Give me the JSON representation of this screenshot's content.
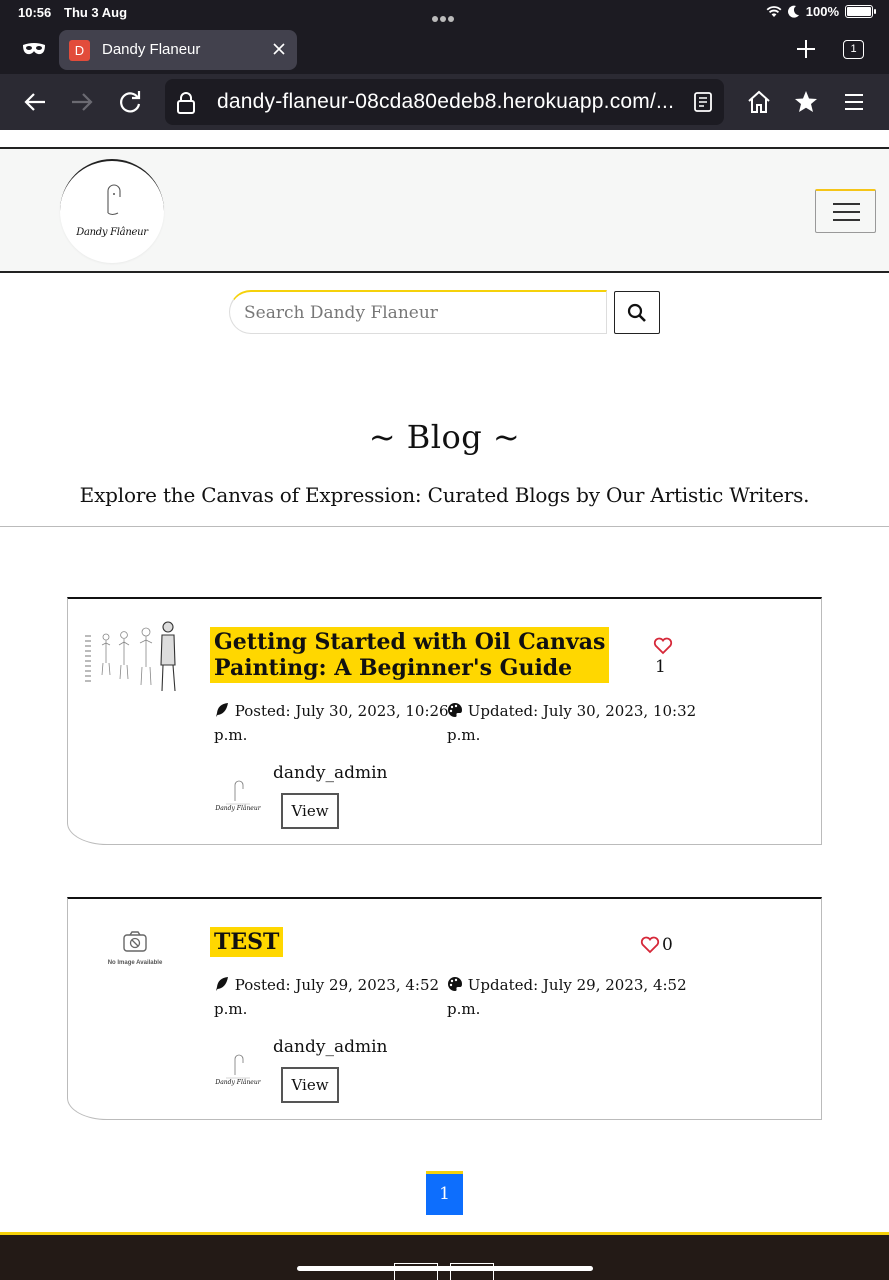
{
  "status_bar": {
    "time": "10:56",
    "date": "Thu 3 Aug",
    "battery": "100%"
  },
  "browser": {
    "tab_favicon_letter": "D",
    "tab_title": "Dandy Flaneur",
    "tab_count": "1",
    "url": "dandy-flaneur-08cda80edeb8.herokuapp.com/..."
  },
  "header": {
    "logo_text": "Dandy Flâneur"
  },
  "search": {
    "placeholder": "Search Dandy Flaneur"
  },
  "blog": {
    "title": "~ Blog ~",
    "subtitle": "Explore the Canvas of Expression: Curated Blogs by Our Artistic Writers."
  },
  "posts": [
    {
      "title_line1": "Getting Started with Oil Canvas",
      "title_line2": "Painting: A Beginner's Guide",
      "likes": "1",
      "posted": "Posted: July 30, 2023, 10:26",
      "posted_cont": "p.m.",
      "updated": "Updated: July 30, 2023, 10:32",
      "updated_cont": "p.m.",
      "author": "dandy_admin",
      "avatar_text": "Dandy Flâneur",
      "view_label": "View"
    },
    {
      "title_line1": "TEST",
      "likes": "0",
      "no_image_text": "No Image Available",
      "posted": "Posted: July 29, 2023, 4:52",
      "posted_cont": "p.m.",
      "updated": "Updated: July 29, 2023, 4:52",
      "updated_cont": "p.m.",
      "author": "dandy_admin",
      "avatar_text": "Dandy Flâneur",
      "view_label": "View"
    }
  ],
  "pagination": {
    "current_page": "1"
  },
  "colors": {
    "accent_yellow": "#ffd700",
    "active_page_blue": "#0d6efd",
    "heart_red": "#d62839",
    "footer_bg": "#231a16"
  }
}
